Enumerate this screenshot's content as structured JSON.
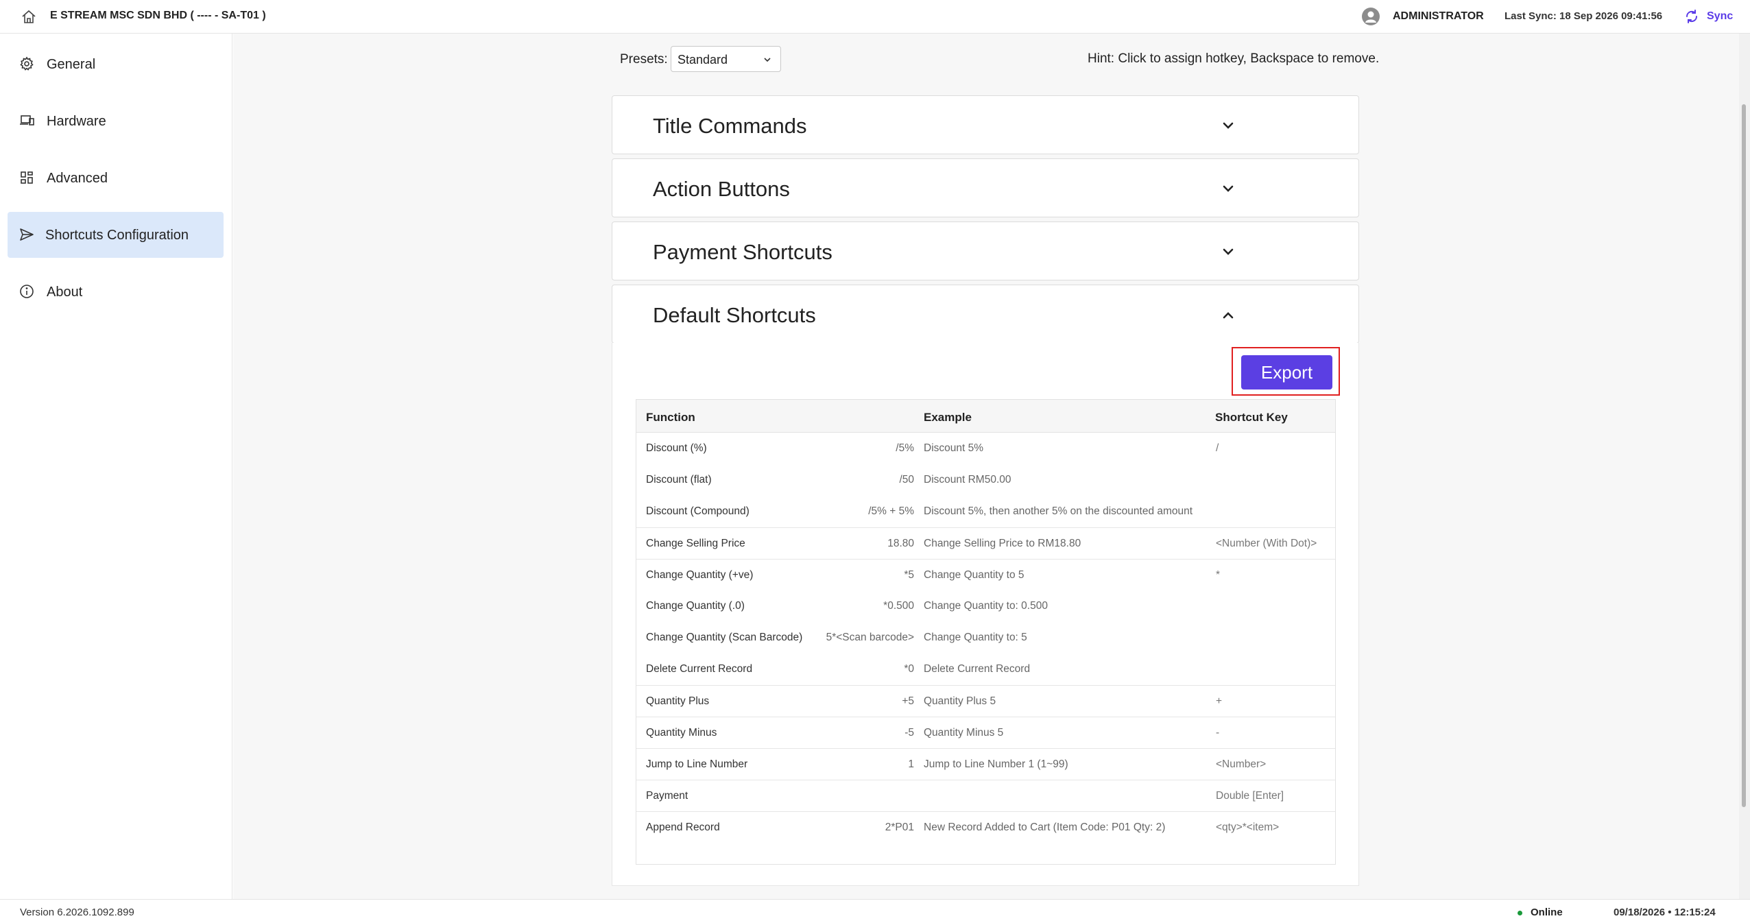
{
  "topbar": {
    "company": "E STREAM MSC SDN BHD ( ---- - SA-T01 )",
    "user": "ADMINISTRATOR",
    "last_sync": "Last Sync: 18 Sep 2026 09:41:56",
    "sync_label": "Sync",
    "accent": "#5a3be8"
  },
  "sidebar": {
    "items": [
      {
        "label": "General",
        "icon": "gear-icon"
      },
      {
        "label": "Hardware",
        "icon": "devices-icon"
      },
      {
        "label": "Advanced",
        "icon": "grid-icon"
      },
      {
        "label": "Shortcuts Configuration",
        "icon": "send-icon",
        "active": true
      },
      {
        "label": "About",
        "icon": "info-icon"
      }
    ],
    "version": "Version 6.2026.1092.899"
  },
  "presets": {
    "label": "Presets:",
    "selected": "Standard",
    "hint": "Hint: Click to assign hotkey, Backspace to remove."
  },
  "accordions": [
    {
      "title": "Title Commands",
      "expanded": false
    },
    {
      "title": "Action Buttons",
      "expanded": false
    },
    {
      "title": "Payment Shortcuts",
      "expanded": false
    },
    {
      "title": "Default Shortcuts",
      "expanded": true
    }
  ],
  "export_label": "Export",
  "table": {
    "headers": [
      "Function",
      "Example",
      "Shortcut Key"
    ],
    "rows": [
      {
        "function": "Discount (%)",
        "code": "/5%",
        "example": "Discount 5%",
        "key": "/"
      },
      {
        "function": "Discount (flat)",
        "code": "/50",
        "example": "Discount RM50.00",
        "key": ""
      },
      {
        "function": "Discount (Compound)",
        "code": "/5% + 5%",
        "example": "Discount 5%, then another 5% on the discounted amount",
        "key": ""
      },
      {
        "function": "Change Selling Price",
        "code": "18.80",
        "example": "Change Selling Price to RM18.80",
        "key": "<Number (With Dot)>"
      },
      {
        "function": "Change Quantity (+ve)",
        "code": "*5",
        "example": "Change Quantity to 5",
        "key": "*"
      },
      {
        "function": "Change Quantity (.0)",
        "code": "*0.500",
        "example": "Change Quantity to: 0.500",
        "key": ""
      },
      {
        "function": "Change Quantity (Scan Barcode)",
        "code": "5*<Scan barcode>",
        "example": "Change Quantity to: 5",
        "key": ""
      },
      {
        "function": "Delete Current Record",
        "code": "*0",
        "example": "Delete Current Record",
        "key": ""
      },
      {
        "function": "Quantity Plus",
        "code": "+5",
        "example": "Quantity Plus 5",
        "key": "+"
      },
      {
        "function": "Quantity Minus",
        "code": "-5",
        "example": "Quantity Minus 5",
        "key": "-"
      },
      {
        "function": "Jump to Line Number",
        "code": "1",
        "example": "Jump to Line Number 1 (1~99)",
        "key": "<Number>"
      },
      {
        "function": "Payment",
        "code": "",
        "example": "",
        "key": "Double [Enter]"
      },
      {
        "function": "Append Record",
        "code": "2*P01",
        "example": "New Record Added to Cart (Item Code: P01 Qty: 2)",
        "key": "<qty>*<item>"
      }
    ]
  },
  "status": {
    "online": "Online",
    "datetime": "09/18/2026  • 12:15:24"
  }
}
